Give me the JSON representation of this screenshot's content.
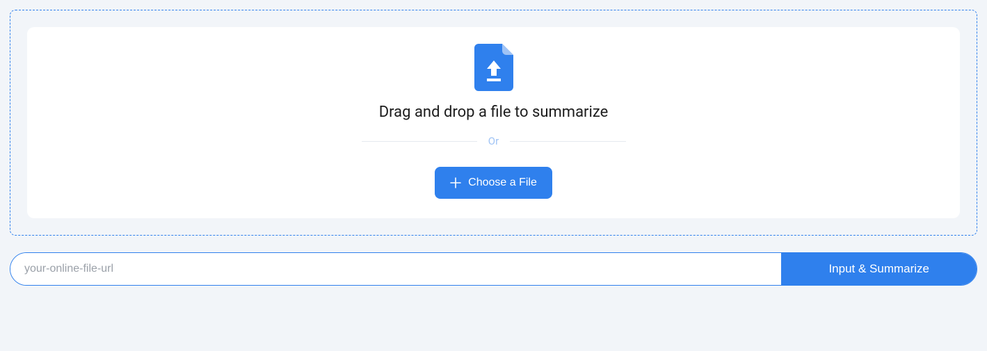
{
  "dropzone": {
    "title": "Drag and drop a file to summarize",
    "divider": "Or",
    "choose_label": "Choose a File"
  },
  "url_form": {
    "placeholder": "your-online-file-url",
    "submit_label": "Input & Summarize"
  },
  "colors": {
    "accent": "#2f80ed",
    "background": "#f2f5f9"
  }
}
